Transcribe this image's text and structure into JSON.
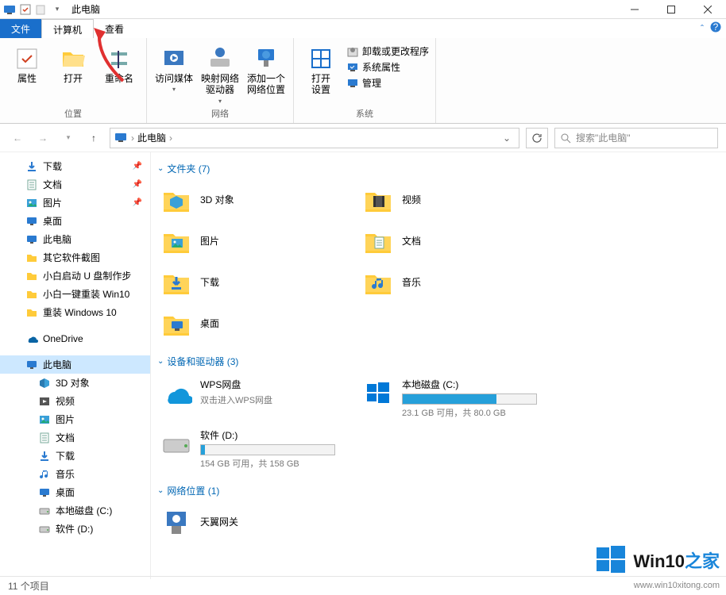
{
  "title": "此电脑",
  "tabs": {
    "file": "文件",
    "computer": "计算机",
    "view": "查看"
  },
  "ribbon": {
    "location": {
      "label": "位置",
      "props": "属性",
      "open": "打开",
      "rename": "重命名"
    },
    "network": {
      "label": "网络",
      "media": "访问媒体",
      "mapdrive": "映射网络\n驱动器",
      "addloc": "添加一个\n网络位置"
    },
    "system": {
      "label": "系统",
      "opensettings": "打开\n设置",
      "uninstall": "卸载或更改程序",
      "sysprops": "系统属性",
      "manage": "管理"
    }
  },
  "nav": {
    "crumb": "此电脑",
    "search_placeholder": "搜索\"此电脑\""
  },
  "sidebar": {
    "quick": [
      {
        "icon": "download",
        "label": "下载",
        "pinned": true
      },
      {
        "icon": "document",
        "label": "文档",
        "pinned": true
      },
      {
        "icon": "picture",
        "label": "图片",
        "pinned": true
      },
      {
        "icon": "desktop",
        "label": "桌面"
      },
      {
        "icon": "thispc",
        "label": "此电脑"
      },
      {
        "icon": "folder",
        "label": "其它软件截图"
      },
      {
        "icon": "folder",
        "label": "小白启动 U 盘制作步"
      },
      {
        "icon": "folder",
        "label": "小白一键重装 Win10"
      },
      {
        "icon": "folder",
        "label": "重装 Windows 10"
      }
    ],
    "onedrive": "OneDrive",
    "thispc": "此电脑",
    "thispc_children": [
      {
        "icon": "cube",
        "label": "3D 对象"
      },
      {
        "icon": "video",
        "label": "视频"
      },
      {
        "icon": "picture",
        "label": "图片"
      },
      {
        "icon": "document",
        "label": "文档"
      },
      {
        "icon": "download",
        "label": "下载"
      },
      {
        "icon": "music",
        "label": "音乐"
      },
      {
        "icon": "desktop",
        "label": "桌面"
      },
      {
        "icon": "disk",
        "label": "本地磁盘 (C:)"
      },
      {
        "icon": "disk",
        "label": "软件 (D:)"
      }
    ]
  },
  "content": {
    "folders_hdr": "文件夹 (7)",
    "folders": [
      {
        "label": "3D 对象"
      },
      {
        "label": "视频"
      },
      {
        "label": "图片"
      },
      {
        "label": "文档"
      },
      {
        "label": "下载"
      },
      {
        "label": "音乐"
      },
      {
        "label": "桌面"
      }
    ],
    "drives_hdr": "设备和驱动器 (3)",
    "drives": [
      {
        "name": "WPS网盘",
        "sub": "双击进入WPS网盘",
        "type": "cloud"
      },
      {
        "name": "本地磁盘 (C:)",
        "sub": "23.1 GB 可用，共 80.0 GB",
        "type": "disk",
        "fill": 70
      },
      {
        "name": "软件 (D:)",
        "sub": "154 GB 可用，共 158 GB",
        "type": "disk",
        "fill": 3
      }
    ],
    "netloc_hdr": "网络位置 (1)",
    "netloc": [
      {
        "name": "天翼网关"
      }
    ]
  },
  "status": "11 个项目",
  "watermark": {
    "brand": "Win10",
    "suffix": "之家",
    "url": "www.win10xitong.com"
  }
}
